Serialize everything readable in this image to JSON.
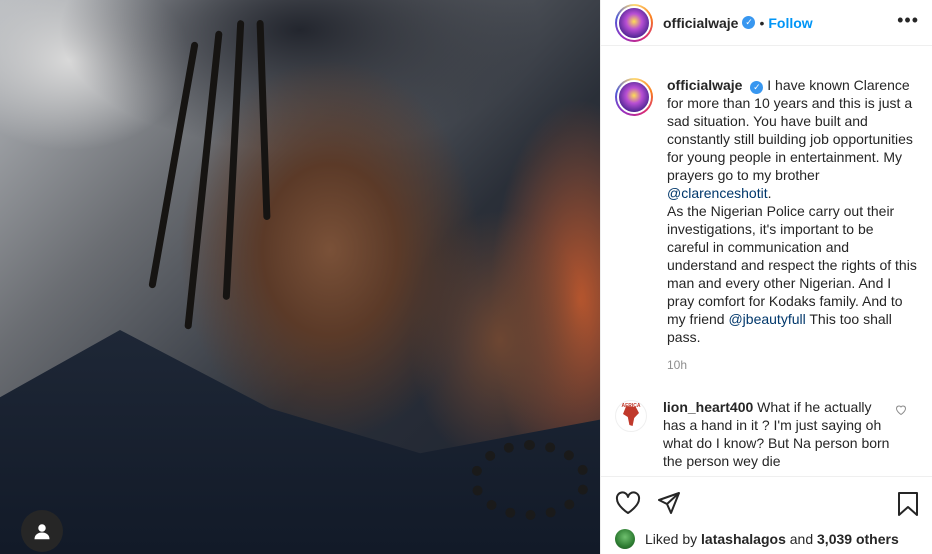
{
  "post": {
    "username": "officialwaje",
    "verified": true,
    "separator": "•",
    "follow_label": "Follow",
    "more_icon": "more-horizontal-icon"
  },
  "caption": {
    "username": "officialwaje",
    "text_part1": "I have known Clarence for more than 10 years and this is just a sad situation. You have built and constantly still building job opportunities for young people in entertainment. My prayers go to my brother",
    "mention1": "@clarenceshotit",
    "text_part2": ".",
    "text_part3": "As the Nigerian Police carry out their investigations, it's important to be careful in communication and understand and respect the rights of this man and every other Nigerian. And I pray comfort for Kodaks family. And to my friend",
    "mention2": "@jbeautyfull",
    "text_part4": "This too shall pass.",
    "time": "10h"
  },
  "comment": {
    "username": "lion_heart400",
    "avatar_label": "AFRICA",
    "text": "What if he actually has a hand in it ? I'm just saying oh what do I know? But Na person born the person wey die"
  },
  "likes": {
    "prefix": "Liked by",
    "user": "latashalagos",
    "middle": "and",
    "count": "3,039 others"
  },
  "colors": {
    "link": "#0095f6",
    "mention": "#00376b",
    "muted": "#8e8e8e"
  }
}
